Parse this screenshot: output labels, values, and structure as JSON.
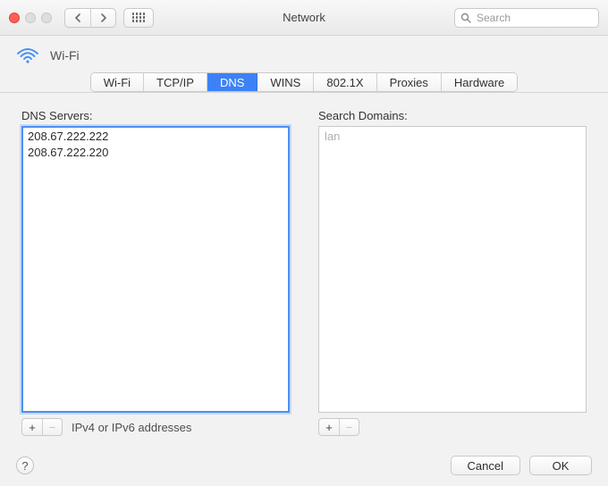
{
  "window": {
    "title": "Network",
    "search_placeholder": "Search",
    "connection_name": "Wi-Fi"
  },
  "tabs": [
    {
      "label": "Wi-Fi",
      "active": false
    },
    {
      "label": "TCP/IP",
      "active": false
    },
    {
      "label": "DNS",
      "active": true
    },
    {
      "label": "WINS",
      "active": false
    },
    {
      "label": "802.1X",
      "active": false
    },
    {
      "label": "Proxies",
      "active": false
    },
    {
      "label": "Hardware",
      "active": false
    }
  ],
  "dns": {
    "label": "DNS Servers:",
    "servers": [
      "208.67.222.222",
      "208.67.222.220"
    ],
    "hint": "IPv4 or IPv6 addresses"
  },
  "search_domains": {
    "label": "Search Domains:",
    "placeholder": "lan",
    "domains": []
  },
  "controls": {
    "add": "+",
    "remove": "−"
  },
  "footer": {
    "help": "?",
    "cancel": "Cancel",
    "ok": "OK"
  }
}
